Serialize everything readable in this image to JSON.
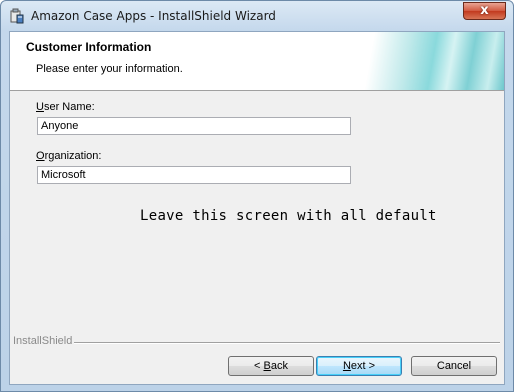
{
  "window": {
    "title": "Amazon Case Apps - InstallShield Wizard",
    "close_label": "x"
  },
  "banner": {
    "title": "Customer Information",
    "subtitle": "Please enter your information."
  },
  "form": {
    "user_name": {
      "label_accel": "U",
      "label_rest": "ser Name:",
      "value": "Anyone"
    },
    "organization": {
      "label_accel": "O",
      "label_rest": "rganization:",
      "value": "Microsoft"
    }
  },
  "note": "Leave this screen with all default",
  "footer": {
    "brand": "InstallShield"
  },
  "buttons": {
    "back": {
      "prefix": "< ",
      "accel": "B",
      "rest": "ack"
    },
    "next": {
      "accel": "N",
      "rest": "ext >"
    },
    "cancel": {
      "label": "Cancel"
    }
  },
  "colors": {
    "close_button": "#c23a1f",
    "default_button_border": "#3c7fb1",
    "banner_accent": "#8ad9dc"
  },
  "icons": {
    "app": "installer-icon",
    "close": "close-icon"
  }
}
